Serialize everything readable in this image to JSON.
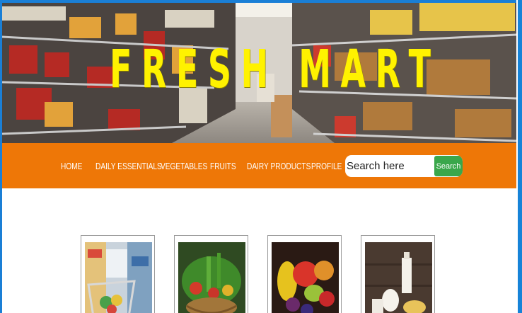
{
  "banner": {
    "title": "FRESH MART"
  },
  "nav": {
    "items": [
      {
        "label": "HOME"
      },
      {
        "label": "DAILY ESSENTIALS"
      },
      {
        "label": "VEGETABLES"
      },
      {
        "label": "FRUITS"
      },
      {
        "label": "DAIRY PRODUCTS"
      },
      {
        "label": "PROFILE"
      }
    ]
  },
  "search": {
    "placeholder": "Search here",
    "button_label": "Search"
  },
  "categories": [
    {
      "image": "supermarket-trolley-image"
    },
    {
      "image": "vegetable-basket-image"
    },
    {
      "image": "fruits-image"
    },
    {
      "image": "dairy-products-image"
    }
  ],
  "colors": {
    "nav_background": "#ee7707",
    "title_yellow": "#fff200",
    "search_button": "#3aa74b",
    "frame_blue": "#1a7fd6"
  }
}
